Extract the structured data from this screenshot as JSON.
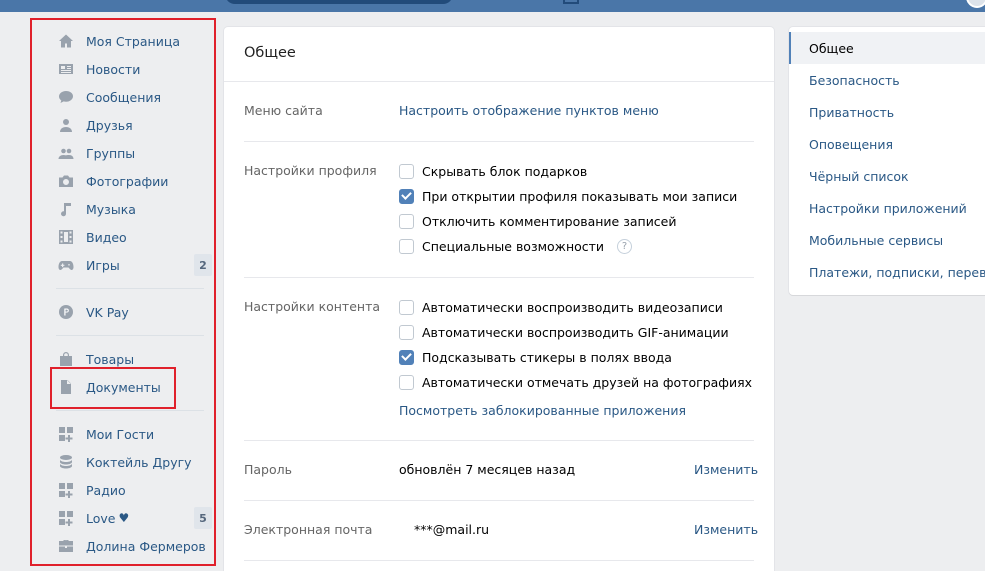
{
  "left_menu": {
    "items": [
      {
        "label": "Моя Страница",
        "icon": "home-icon"
      },
      {
        "label": "Новости",
        "icon": "news-icon"
      },
      {
        "label": "Сообщения",
        "icon": "messages-icon"
      },
      {
        "label": "Друзья",
        "icon": "friends-icon"
      },
      {
        "label": "Группы",
        "icon": "groups-icon"
      },
      {
        "label": "Фотографии",
        "icon": "camera-icon"
      },
      {
        "label": "Музыка",
        "icon": "music-icon"
      },
      {
        "label": "Видео",
        "icon": "video-icon"
      },
      {
        "label": "Игры",
        "icon": "gamepad-icon",
        "counter": "2"
      },
      {
        "label": "VK Pay",
        "icon": "vkpay-icon"
      },
      {
        "label": "Товары",
        "icon": "bag-icon"
      },
      {
        "label": "Документы",
        "icon": "document-icon"
      },
      {
        "label": "Мои Гости",
        "icon": "app-icon"
      },
      {
        "label": "Коктейль Другу",
        "icon": "stack-icon"
      },
      {
        "label": "Радио",
        "icon": "app-icon"
      },
      {
        "label": "Love",
        "icon": "app-icon",
        "counter": "5",
        "suffix": "♥"
      },
      {
        "label": "Долина Фермеров",
        "icon": "briefcase-icon"
      }
    ]
  },
  "main": {
    "title": "Общее",
    "menu_row": {
      "label": "Меню сайта",
      "link": "Настроить отображение пунктов меню"
    },
    "profile_row": {
      "label": "Настройки профиля",
      "options": [
        {
          "text": "Скрывать блок подарков",
          "checked": false
        },
        {
          "text": "При открытии профиля показывать мои записи",
          "checked": true
        },
        {
          "text": "Отключить комментирование записей",
          "checked": false
        },
        {
          "text": "Специальные возможности",
          "checked": false
        }
      ],
      "help_glyph": "?"
    },
    "content_row": {
      "label": "Настройки контента",
      "options": [
        {
          "text": "Автоматически воспроизводить видеозаписи",
          "checked": false
        },
        {
          "text": "Автоматически воспроизводить GIF-анимации",
          "checked": false
        },
        {
          "text": "Подсказывать стикеры в полях ввода",
          "checked": true
        },
        {
          "text": "Автоматически отмечать друзей на фотографиях",
          "checked": false
        }
      ],
      "link": "Посмотреть заблокированные приложения"
    },
    "password_row": {
      "label": "Пароль",
      "value": "обновлён 7 месяцев назад",
      "action": "Изменить"
    },
    "email_row": {
      "label": "Электронная почта",
      "value": "***@mail.ru",
      "action": "Изменить"
    }
  },
  "right_menu": {
    "items": [
      {
        "label": "Общее",
        "active": true
      },
      {
        "label": "Безопасность",
        "active": false
      },
      {
        "label": "Приватность",
        "active": false
      },
      {
        "label": "Оповещения",
        "active": false
      },
      {
        "label": "Чёрный список",
        "active": false
      },
      {
        "label": "Настройки приложений",
        "active": false
      },
      {
        "label": "Мобильные сервисы",
        "active": false
      },
      {
        "label": "Платежи, подписки, переводы",
        "active": false
      }
    ]
  },
  "colors": {
    "accent": "#5181b8",
    "link": "#2a5885",
    "highlight_border": "#e0202b",
    "background": "#edeef0"
  }
}
